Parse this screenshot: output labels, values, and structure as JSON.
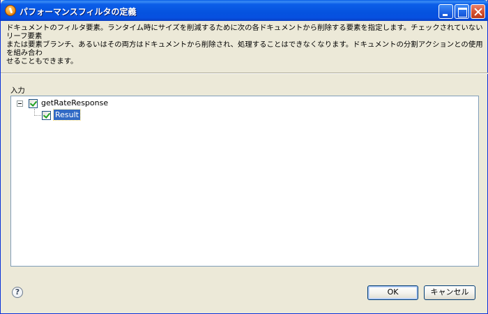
{
  "window": {
    "title": "パフォーマンスフィルタの定義"
  },
  "description": "ドキュメントのフィルタ要素。ランタイム時にサイズを削減するために次の各ドキュメントから削除する要素を指定します。チェックされていないリーフ要素\nまたは要素ブランチ、あるいはその両方はドキュメントから削除され、処理することはできなくなります。ドキュメントの分割アクションとの使用を組み合わ\nせることもできます。",
  "input_label": "入力",
  "tree": {
    "root": {
      "label": "getRateResponse",
      "checked": true,
      "expanded": true
    },
    "children": [
      {
        "label": "Result",
        "checked": true,
        "selected": true
      }
    ]
  },
  "buttons": {
    "ok": "OK",
    "cancel": "キャンセル",
    "help": "?"
  },
  "colors": {
    "selection": "#316ac5",
    "titlebar": "#0553df",
    "dialog_background": "#ece9d8"
  }
}
